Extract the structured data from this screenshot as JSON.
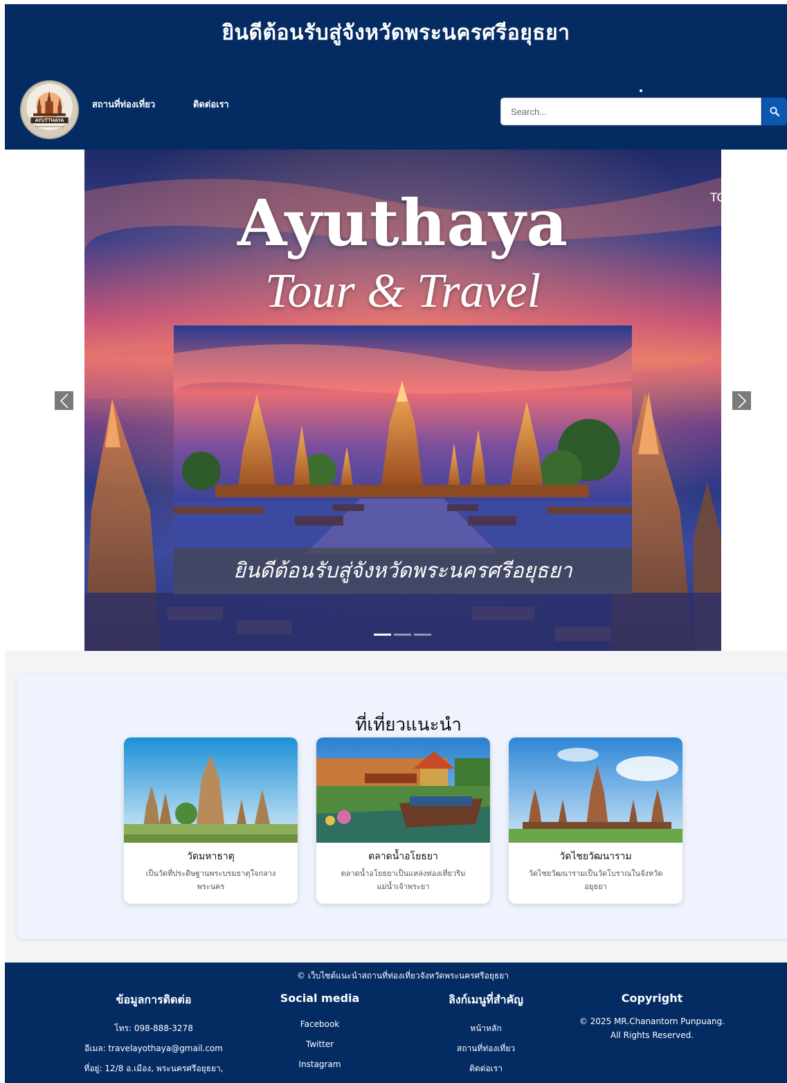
{
  "header": {
    "title": "ยินดีต้อนรับสู่จังหวัดพระนครศรีอยุธยา",
    "logo_text": "AYUTTHAYA",
    "nav": [
      "สถานที่ท่องเที่ยว",
      "ติดต่อเรา"
    ],
    "search_placeholder": "Search...",
    "search_icon": "search-icon"
  },
  "carousel": {
    "title": "Ayuthaya",
    "subtitle": "Tour & Travel",
    "caption": "ยินดีต้อนรับสู่จังหวัดพระนครศรีอยุธยา",
    "side_text": "TC",
    "slides": 3,
    "active_slide": 1,
    "prev_icon": "chevron-left-icon",
    "next_icon": "chevron-right-icon"
  },
  "recommended": {
    "title": "ที่เที่ยวแนะนำ",
    "cards": [
      {
        "title": "วัดมหาธาตุ",
        "desc": "เป็นวัดที่ประดิษฐานพระบรมธาตุใจกลางพระนคร"
      },
      {
        "title": "ตลาดน้ำอโยธยา",
        "desc": "ตลาดน้ำอโยธยาเป็นแหล่งท่องเที่ยวริมแม่น้ำเจ้าพระยา"
      },
      {
        "title": "วัดไชยวัฒนาราม",
        "desc": "วัดไชยวัฒนารามเป็นวัดโบราณในจังหวัดอยุธยา"
      }
    ]
  },
  "footer": {
    "top_text": "© เว็บไซต์แนะนำสถานที่ท่องเที่ยวจังหวัดพระนครศรีอยุธยา",
    "contact": {
      "heading": "ข้อมูลการติดต่อ",
      "phone": "โทร: 098-888-3278",
      "email": "อีเมล: travelayothaya@gmail.com",
      "address": "ที่อยู่: 12/8 อ.เมือง, พระนครศรีอยุธยา,"
    },
    "social": {
      "heading": "Social media",
      "items": [
        "Facebook",
        "Twitter",
        "Instagram"
      ]
    },
    "links": {
      "heading": "ลิงก์เมนูที่สำคัญ",
      "items": [
        "หน้าหลัก",
        "สถานที่ท่องเที่ยว",
        "ติดต่อเรา"
      ]
    },
    "copyright": {
      "heading": "Copyright",
      "line1": "© 2025 MR.Chanantorn Punpuang.",
      "line2": "All Rights Reserved."
    }
  },
  "colors": {
    "navy": "#042c63",
    "search_button": "#0b57b0",
    "panel": "#eef3fd"
  }
}
